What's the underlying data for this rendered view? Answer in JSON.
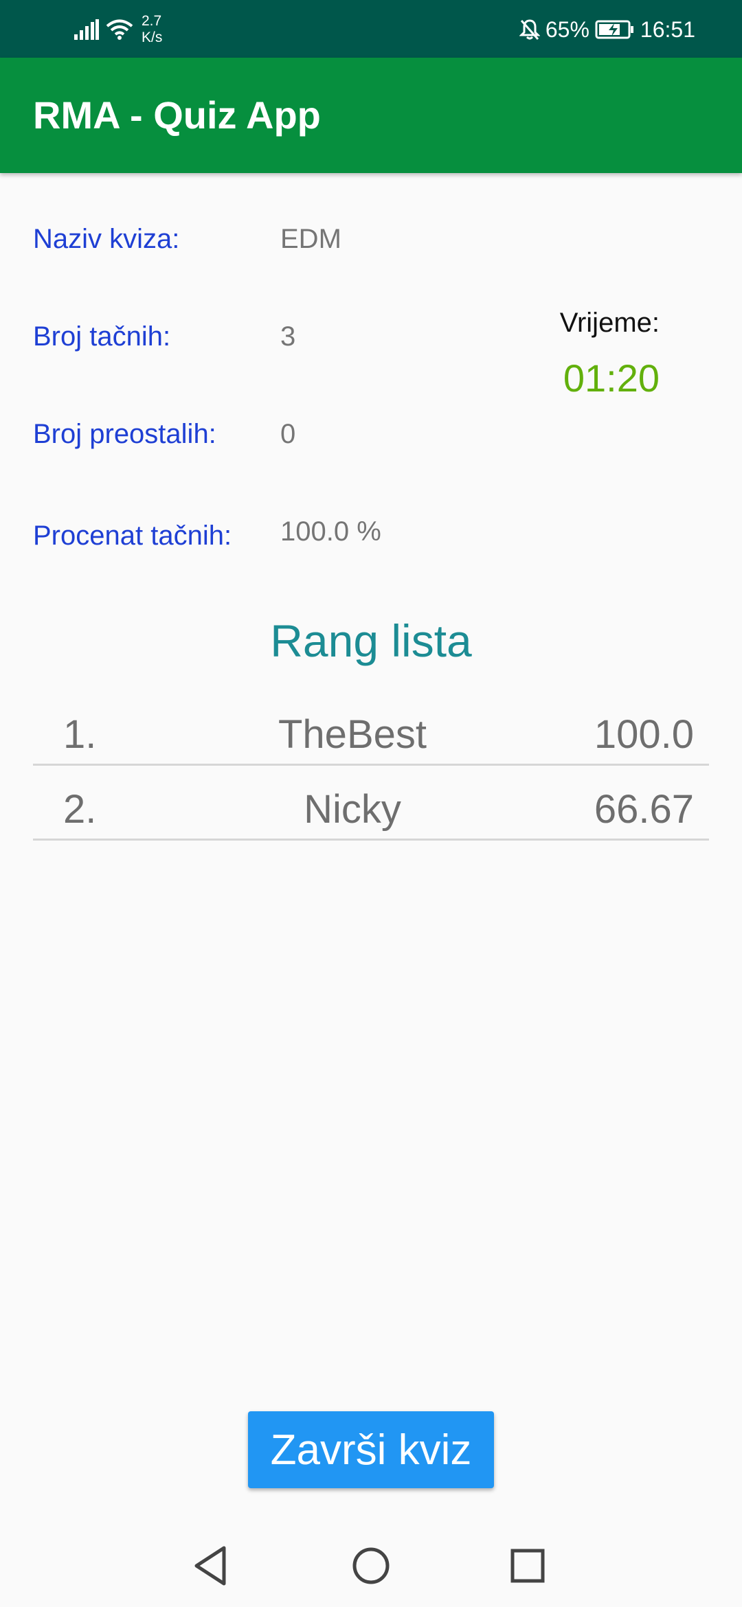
{
  "status_bar": {
    "network_speed_value": "2.7",
    "network_speed_unit": "K/s",
    "battery": "65%",
    "time": "16:51",
    "icons": [
      "signal-icon",
      "wifi-icon",
      "bell-off-icon",
      "battery-charging-icon"
    ]
  },
  "app_bar": {
    "title": "RMA - Quiz App"
  },
  "quiz_info": {
    "name_label": "Naziv kviza:",
    "name_value": "EDM",
    "correct_label": "Broj tačnih:",
    "correct_value": "3",
    "remaining_label": "Broj preostalih:",
    "remaining_value": "0",
    "percent_label": "Procenat tačnih:",
    "percent_value": "100.0 %"
  },
  "timer": {
    "label": "Vrijeme:",
    "value": "01:20"
  },
  "ranking": {
    "title": "Rang lista",
    "rows": [
      {
        "position": "1.",
        "name": "TheBest",
        "score": "100.0"
      },
      {
        "position": "2.",
        "name": "Nicky",
        "score": "66.67"
      }
    ]
  },
  "finish_button": {
    "label": "Završi kviz"
  },
  "nav_bar": {
    "icons": [
      "back-icon",
      "home-icon",
      "recents-icon"
    ]
  },
  "colors": {
    "status_bar": "#00574b",
    "app_bar": "#068f3e",
    "label_blue": "#1e3fd4",
    "timer_green": "#62b00c",
    "rank_title_teal": "#1c8c94",
    "button_blue": "#2196f3"
  }
}
